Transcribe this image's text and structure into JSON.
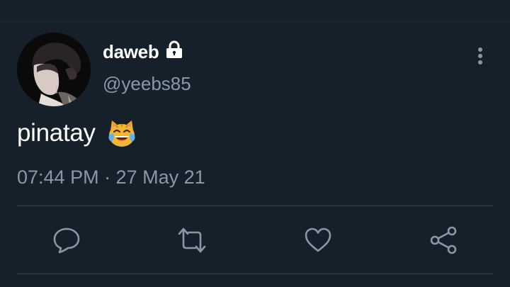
{
  "tweet": {
    "display_name": "daweb",
    "handle": "@yeebs85",
    "text": "pinatay",
    "timestamp": "07:44 PM · 27 May 21",
    "protected_icon": "lock-icon",
    "emoji_icon": "cat-with-tears-of-joy-icon"
  },
  "actions": {
    "reply_icon": "reply-icon",
    "retweet_icon": "retweet-icon",
    "like_icon": "heart-icon",
    "share_icon": "share-icon"
  },
  "colors": {
    "background": "#15202b",
    "primary_text": "#ffffff",
    "secondary_text": "#8899a6",
    "divider": "#38444d"
  }
}
